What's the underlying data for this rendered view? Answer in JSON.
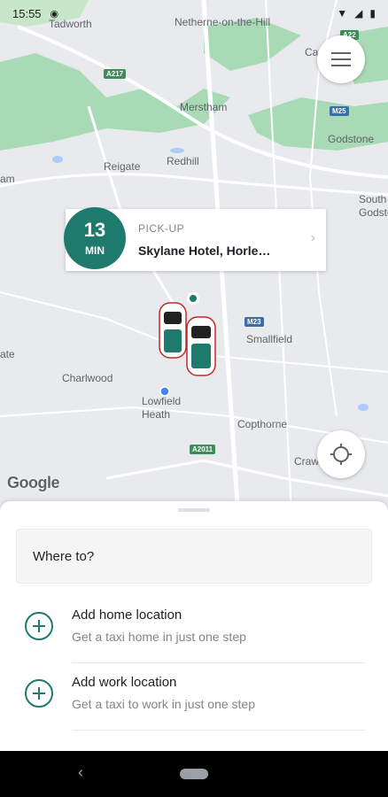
{
  "status_bar": {
    "time": "15:55",
    "eye_icon": "eye-icon",
    "right_icons": [
      "wifi-icon",
      "signal-icon",
      "battery-icon"
    ]
  },
  "map": {
    "labels": [
      "Tadworth",
      "Netherne-on-the-Hill",
      "Merstham",
      "Reigate",
      "Redhill",
      "Godstone",
      "Smallfield",
      "Charlwood",
      "Lowfield Heath",
      "Copthorne",
      "Crawley",
      "Cat",
      "South Godstone",
      "am",
      "ate"
    ],
    "road_shields": [
      "A217",
      "M25",
      "M23",
      "A2011",
      "A22"
    ],
    "attribution": "Google"
  },
  "pickup": {
    "eta_number": "13",
    "eta_unit": "MIN",
    "label": "PICK-UP",
    "address": "Skylane Hotel, Horle…"
  },
  "sheet": {
    "search_placeholder": "Where to?",
    "home": {
      "title": "Add home location",
      "subtitle": "Get a taxi home in just one step"
    },
    "work": {
      "title": "Add work location",
      "subtitle": "Get a taxi to work in just one step"
    }
  },
  "colors": {
    "accent": "#1d7a6d",
    "map_green": "#a8dab5",
    "map_background": "#e8eaed"
  }
}
